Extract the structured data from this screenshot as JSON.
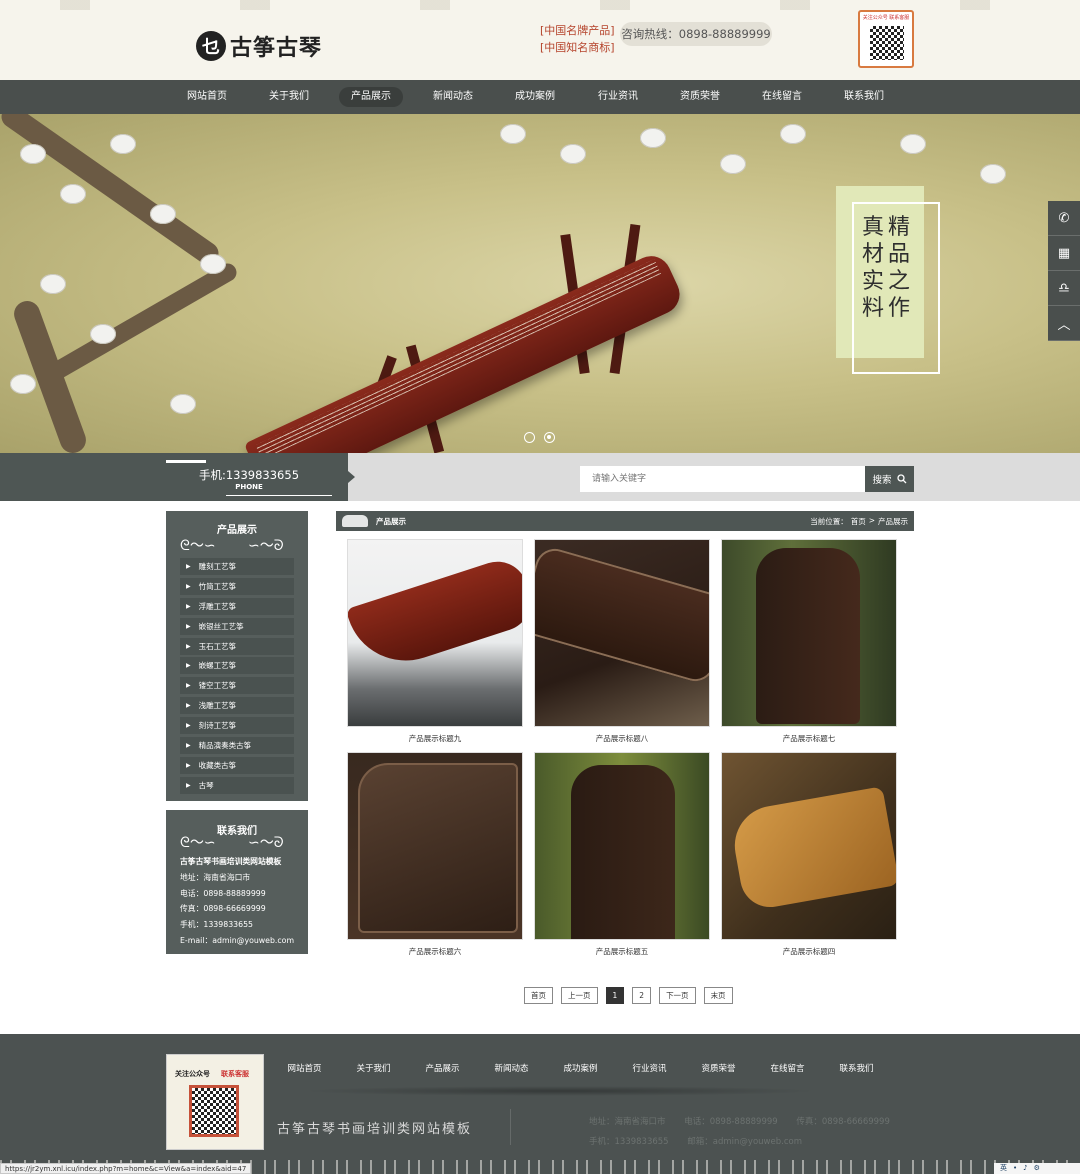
{
  "header": {
    "logo_mark": "乜",
    "logo_text": "古筝古琴",
    "brand_tags": [
      "[中国名牌产品]",
      "[中国知名商标]"
    ],
    "hotline": "咨询热线：0898-88889999",
    "qr_title": "关注公众号 联系客服"
  },
  "nav": {
    "items": [
      "网站首页",
      "关于我们",
      "产品展示",
      "新闻动态",
      "成功案例",
      "行业资讯",
      "资质荣誉",
      "在线留言",
      "联系我们"
    ],
    "active_index": 2
  },
  "banner": {
    "text_cols": [
      "精品之作",
      "真材实料"
    ],
    "dots": 2,
    "active_dot": 1
  },
  "side_float": {
    "icons": [
      "phone-icon",
      "qrcode-icon",
      "qq-icon",
      "back-to-top-icon"
    ],
    "glyphs": [
      "✆",
      "▦",
      "♎",
      "︿"
    ]
  },
  "bar": {
    "phone": "手机:1339833655",
    "phone_sub": "PHONE",
    "search_placeholder": "请输入关键字",
    "search_button": "搜索"
  },
  "sidebar": {
    "title": "产品展示",
    "items": [
      "雕刻工艺筝",
      "竹简工艺筝",
      "浮雕工艺筝",
      "嵌银丝工艺筝",
      "玉石工艺筝",
      "嵌螺工艺筝",
      "镂空工艺筝",
      "浅雕工艺筝",
      "刻诗工艺筝",
      "精品演奏类古筝",
      "收藏类古筝",
      "古琴"
    ]
  },
  "contact": {
    "title": "联系我们",
    "company": "古筝古琴书画培训类网站模板",
    "address": "地址：海南省海口市",
    "tel": "电话：0898-88889999",
    "fax": "传真：0898-66669999",
    "mobile": "手机：1339833655",
    "email": "E-mail：admin@youweb.com"
  },
  "main": {
    "section_title": "产品展示",
    "crumb_prefix": "当前位置：",
    "crumb_home": "首页",
    "crumb_sep": ">",
    "crumb_current": "产品展示",
    "products": [
      "产品展示标题九",
      "产品展示标题八",
      "产品展示标题七",
      "产品展示标题六",
      "产品展示标题五",
      "产品展示标题四"
    ]
  },
  "pager": {
    "first": "首页",
    "prev": "上一页",
    "pages": [
      "1",
      "2"
    ],
    "current": "1",
    "next": "下一页",
    "last": "末页"
  },
  "footer": {
    "qr_head": "关注公众号",
    "qr_head2": "联系客服",
    "nav": [
      "网站首页",
      "关于我们",
      "产品展示",
      "新闻动态",
      "成功案例",
      "行业资讯",
      "资质荣誉",
      "在线留言",
      "联系我们"
    ],
    "slogan": "古筝古琴书画培训类网站模板",
    "address": "地址：海南省海口市",
    "tel": "电话：0898-88889999",
    "fax": "传真：0898-66669999",
    "mobile": "手机：1339833655",
    "email": "邮箱：admin@youweb.com"
  },
  "status_url": "https://jr2ym.xnl.icu/index.php?m=home&c=View&a=index&aid=47",
  "tray": {
    "lang": "英",
    "glyphs": [
      "•",
      "♪",
      "⚙"
    ]
  },
  "colors": {
    "nav_bg": "#4a4f4d",
    "panel_bg": "#565e5c",
    "accent_red": "#b5432b",
    "banner_box": "#e1e8b8"
  }
}
